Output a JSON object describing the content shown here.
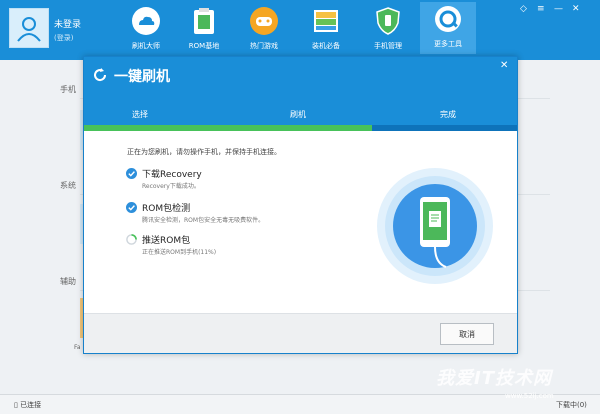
{
  "user": {
    "name": "未登录",
    "sub": "(登录)"
  },
  "nav": [
    {
      "label": "刷机大师",
      "icon": "cloud-icon"
    },
    {
      "label": "ROM基地",
      "icon": "rom-bag-icon"
    },
    {
      "label": "热门游戏",
      "icon": "gamepad-icon"
    },
    {
      "label": "装机必备",
      "icon": "apps-icon"
    },
    {
      "label": "手机管理",
      "icon": "shield-icon"
    },
    {
      "label": "更多工具",
      "icon": "tools-icon"
    }
  ],
  "background": {
    "sections": [
      "手机",
      "系统",
      "辅助"
    ],
    "card_letter": "Fa"
  },
  "dialog": {
    "title": "一键刷机",
    "steps": [
      "选择",
      "刷机",
      "完成"
    ],
    "hint": "正在为您刷机，请勿操作手机，并保持手机连接。",
    "items": [
      {
        "title": "下载Recovery",
        "sub": "Recovery下载成功。",
        "state": "done"
      },
      {
        "title": "ROM包检测",
        "sub": "腾讯安全检测，ROM包安全无毒无吸费软件。",
        "state": "done"
      },
      {
        "title": "推送ROM包",
        "sub": "正在推送ROM到手机(11%)",
        "state": "in-progress"
      }
    ],
    "cancel_label": "取消"
  },
  "progress": {
    "push_rom_percent": 11
  },
  "status_bar": {
    "left": "已连接",
    "right": "下载中(0)"
  },
  "watermark": {
    "text": "我爱IT技术网",
    "url": "www.52ij.com"
  },
  "colors": {
    "brand_blue": "#1a8ed8",
    "step_green": "#48c25a"
  }
}
